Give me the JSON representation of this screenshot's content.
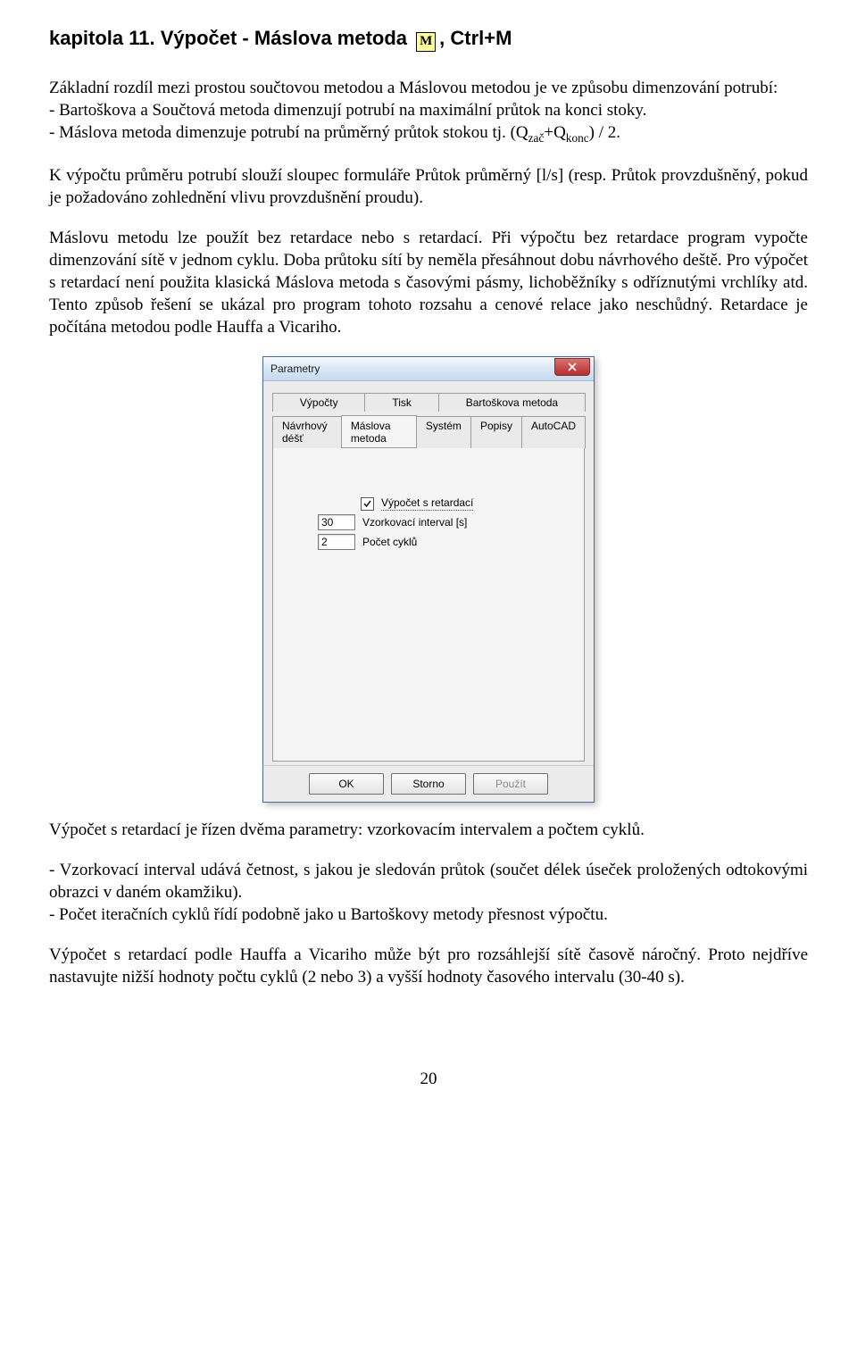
{
  "heading": {
    "prefix": "kapitola 11. Výpočet - Máslova metoda",
    "icon_letter": "M",
    "suffix": ", Ctrl+M"
  },
  "para1": {
    "line1": "Základní rozdíl mezi prostou součtovou metodou a Máslovou metodou je ve způsobu dimenzování potrubí:",
    "bullet1": "- Bartoškova a Součtová metoda dimenzují potrubí na maximální průtok na konci stoky.",
    "bullet2_prefix": "- Máslova metoda dimenzuje potrubí na průměrný průtok stokou tj. (Q",
    "sub1": "zač",
    "mid": "+Q",
    "sub2": "konc",
    "bullet2_suffix": ") / 2."
  },
  "para2": "K výpočtu průměru potrubí slouží sloupec formuláře Průtok průměrný [l/s] (resp. Průtok provzdušněný, pokud je požadováno zohlednění vlivu provzdušnění proudu).",
  "para3": "Máslovu metodu lze použít bez retardace nebo s retardací. Při výpočtu bez retardace program vypočte dimenzování sítě v jednom cyklu. Doba průtoku sítí by neměla přesáhnout dobu návrhového deště. Pro výpočet s retardací není použita klasická Máslova metoda s časovými pásmy, lichoběžníky s odříznutými vrchlíky atd. Tento způsob řešení se ukázal pro program tohoto rozsahu a cenové relace jako neschůdný. Retardace je počítána metodou podle Hauffa a Vicariho.",
  "dialog": {
    "title": "Parametry",
    "tabs_row1": [
      "Výpočty",
      "Tisk",
      "Bartoškova metoda"
    ],
    "tabs_row2": [
      "Návrhový déšť",
      "Máslova metoda",
      "Systém",
      "Popisy",
      "AutoCAD"
    ],
    "tabs_row2_active_index": 1,
    "chk_label": "Výpočet s retardací",
    "chk_checked": true,
    "interval_value": "30",
    "interval_label": "Vzorkovací interval [s]",
    "cycles_value": "2",
    "cycles_label": "Počet cyklů",
    "buttons": {
      "ok": "OK",
      "cancel": "Storno",
      "apply": "Použít"
    }
  },
  "para4": "Výpočet s retardací je řízen dvěma parametry: vzorkovacím intervalem a počtem cyklů.",
  "para5a": "- Vzorkovací interval udává četnost, s jakou je sledován průtok (součet délek úseček proložených odtokovými obrazci v daném okamžiku).",
  "para5b": "- Počet iteračních cyklů řídí podobně jako u Bartoškovy metody přesnost výpočtu.",
  "para6": "Výpočet s retardací podle Hauffa a Vicariho může být pro rozsáhlejší sítě časově náročný. Proto nejdříve nastavujte nižší hodnoty počtu cyklů (2 nebo 3) a vyšší hodnoty časového intervalu (30-40 s).",
  "page_number": "20"
}
